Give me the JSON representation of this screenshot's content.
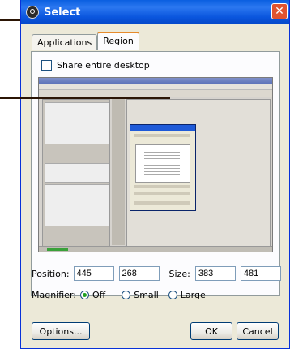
{
  "window": {
    "title": "Select",
    "close_glyph": "✕"
  },
  "tabs": [
    {
      "label": "Applications"
    },
    {
      "label": "Region"
    }
  ],
  "share_desktop": {
    "label": "Share entire desktop",
    "checked": false
  },
  "position": {
    "label": "Position:",
    "x": "445",
    "y": "268"
  },
  "size": {
    "label": "Size:",
    "width": "383",
    "height": "481"
  },
  "magnifier": {
    "label": "Magnifier:",
    "options": [
      "Off",
      "Small",
      "Large"
    ],
    "selected": "Off"
  },
  "buttons": {
    "options": "Options...",
    "ok": "OK",
    "cancel": "Cancel"
  }
}
